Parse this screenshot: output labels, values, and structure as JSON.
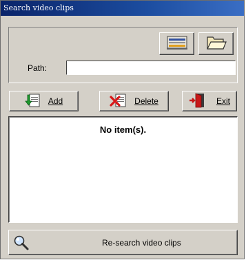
{
  "window": {
    "title": "Search video clips"
  },
  "path": {
    "label": "Path:",
    "value": ""
  },
  "toolbar": {
    "settings_icon": "list-config-icon",
    "folder_icon": "folder-open-icon"
  },
  "actions": {
    "add_label": "Add",
    "delete_label": "Delete",
    "exit_label": "Exit"
  },
  "list": {
    "empty_message": "No item(s)."
  },
  "research": {
    "label": "Re-search video clips",
    "icon": "search-icon"
  }
}
